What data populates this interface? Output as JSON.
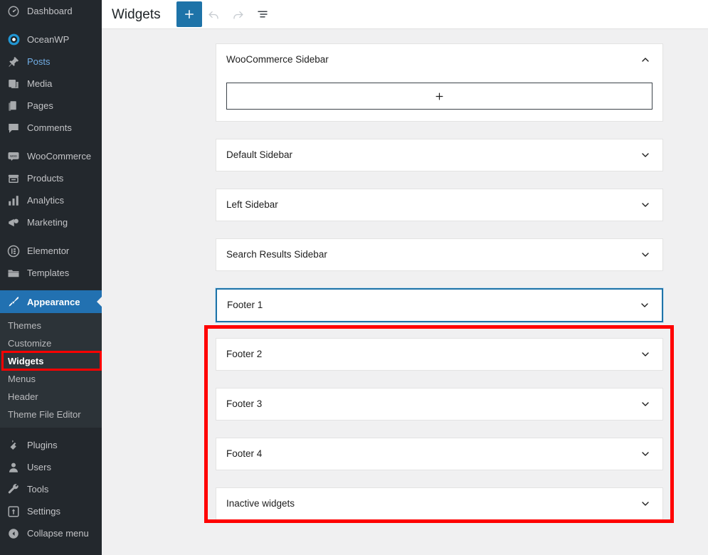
{
  "sidebar": {
    "items": [
      {
        "label": "Dashboard",
        "icon": "dashboard-icon",
        "style": "normal"
      },
      {
        "label": "OceanWP",
        "icon": "oceanwp-icon",
        "style": "spaced"
      },
      {
        "label": "Posts",
        "icon": "pin-icon",
        "style": "link-blue"
      },
      {
        "label": "Media",
        "icon": "media-icon",
        "style": "normal"
      },
      {
        "label": "Pages",
        "icon": "pages-icon",
        "style": "normal"
      },
      {
        "label": "Comments",
        "icon": "comments-icon",
        "style": "normal"
      },
      {
        "label": "WooCommerce",
        "icon": "woocommerce-icon",
        "style": "spaced"
      },
      {
        "label": "Products",
        "icon": "products-icon",
        "style": "normal"
      },
      {
        "label": "Analytics",
        "icon": "analytics-icon",
        "style": "normal"
      },
      {
        "label": "Marketing",
        "icon": "marketing-icon",
        "style": "normal"
      },
      {
        "label": "Elementor",
        "icon": "elementor-icon",
        "style": "spaced"
      },
      {
        "label": "Templates",
        "icon": "templates-icon",
        "style": "normal"
      }
    ],
    "active_item": {
      "label": "Appearance",
      "icon": "appearance-icon"
    },
    "submenu": [
      {
        "label": "Themes",
        "current": false
      },
      {
        "label": "Customize",
        "current": false
      },
      {
        "label": "Widgets",
        "current": true
      },
      {
        "label": "Menus",
        "current": false
      },
      {
        "label": "Header",
        "current": false
      },
      {
        "label": "Theme File Editor",
        "current": false
      }
    ],
    "bottom_items": [
      {
        "label": "Plugins",
        "icon": "plugins-icon",
        "style": "spaced"
      },
      {
        "label": "Users",
        "icon": "users-icon",
        "style": "normal"
      },
      {
        "label": "Tools",
        "icon": "tools-icon",
        "style": "normal"
      },
      {
        "label": "Settings",
        "icon": "settings-icon",
        "style": "normal"
      },
      {
        "label": "Collapse menu",
        "icon": "collapse-icon",
        "style": "collapse"
      }
    ]
  },
  "toolbar": {
    "title": "Widgets",
    "add_label": "+",
    "add_icon": "plus-icon",
    "undo_icon": "undo-icon",
    "redo_icon": "redo-icon",
    "list_view_icon": "list-view-icon"
  },
  "panels": [
    {
      "title": "WooCommerce Sidebar",
      "expanded": true,
      "focused": false,
      "chevron": "chevron-up-icon",
      "in_highlight": false
    },
    {
      "title": "Default Sidebar",
      "expanded": false,
      "focused": false,
      "chevron": "chevron-down-icon",
      "in_highlight": false
    },
    {
      "title": "Left Sidebar",
      "expanded": false,
      "focused": false,
      "chevron": "chevron-down-icon",
      "in_highlight": false
    },
    {
      "title": "Search Results Sidebar",
      "expanded": false,
      "focused": false,
      "chevron": "chevron-down-icon",
      "in_highlight": false
    },
    {
      "title": "Footer 1",
      "expanded": false,
      "focused": true,
      "chevron": "chevron-down-icon",
      "in_highlight": true
    },
    {
      "title": "Footer 2",
      "expanded": false,
      "focused": false,
      "chevron": "chevron-down-icon",
      "in_highlight": true
    },
    {
      "title": "Footer 3",
      "expanded": false,
      "focused": false,
      "chevron": "chevron-down-icon",
      "in_highlight": true
    },
    {
      "title": "Footer 4",
      "expanded": false,
      "focused": false,
      "chevron": "chevron-down-icon",
      "in_highlight": true
    },
    {
      "title": "Inactive widgets",
      "expanded": false,
      "focused": false,
      "chevron": "chevron-down-icon",
      "in_highlight": false
    }
  ],
  "dropzone": {
    "label": "+",
    "icon": "plus-icon"
  },
  "annotations": {
    "widgets_highlight_color": "#ff0000",
    "footers_highlight_color": "#ff0000"
  },
  "colors": {
    "sidebar_bg": "#23282d",
    "submenu_bg": "#2c3338",
    "accent": "#2271b1",
    "page_bg": "#f0f0f1",
    "panel_bg": "#ffffff",
    "focus_border": "#1e73a8"
  }
}
